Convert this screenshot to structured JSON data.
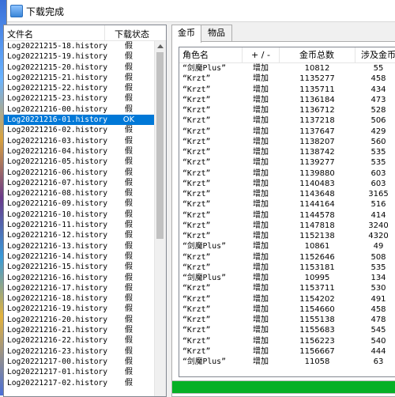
{
  "window": {
    "title": "下载完成"
  },
  "file_list": {
    "columns": [
      "文件名",
      "下载状态"
    ],
    "rows": [
      {
        "file": "Log20221215-18.history",
        "status": "假"
      },
      {
        "file": "Log20221215-19.history",
        "status": "假"
      },
      {
        "file": "Log20221215-20.history",
        "status": "假"
      },
      {
        "file": "Log20221215-21.history",
        "status": "假"
      },
      {
        "file": "Log20221215-22.history",
        "status": "假"
      },
      {
        "file": "Log20221215-23.history",
        "status": "假"
      },
      {
        "file": "Log20221216-00.history",
        "status": "假"
      },
      {
        "file": "Log20221216-01.history",
        "status": "OK",
        "selected": true
      },
      {
        "file": "Log20221216-02.history",
        "status": "假"
      },
      {
        "file": "Log20221216-03.history",
        "status": "假"
      },
      {
        "file": "Log20221216-04.history",
        "status": "假"
      },
      {
        "file": "Log20221216-05.history",
        "status": "假"
      },
      {
        "file": "Log20221216-06.history",
        "status": "假"
      },
      {
        "file": "Log20221216-07.history",
        "status": "假"
      },
      {
        "file": "Log20221216-08.history",
        "status": "假"
      },
      {
        "file": "Log20221216-09.history",
        "status": "假"
      },
      {
        "file": "Log20221216-10.history",
        "status": "假"
      },
      {
        "file": "Log20221216-11.history",
        "status": "假"
      },
      {
        "file": "Log20221216-12.history",
        "status": "假"
      },
      {
        "file": "Log20221216-13.history",
        "status": "假"
      },
      {
        "file": "Log20221216-14.history",
        "status": "假"
      },
      {
        "file": "Log20221216-15.history",
        "status": "假"
      },
      {
        "file": "Log20221216-16.history",
        "status": "假"
      },
      {
        "file": "Log20221216-17.history",
        "status": "假"
      },
      {
        "file": "Log20221216-18.history",
        "status": "假"
      },
      {
        "file": "Log20221216-19.history",
        "status": "假"
      },
      {
        "file": "Log20221216-20.history",
        "status": "假"
      },
      {
        "file": "Log20221216-21.history",
        "status": "假"
      },
      {
        "file": "Log20221216-22.history",
        "status": "假"
      },
      {
        "file": "Log20221216-23.history",
        "status": "假"
      },
      {
        "file": "Log20221217-00.history",
        "status": "假"
      },
      {
        "file": "Log20221217-01.history",
        "status": "假"
      },
      {
        "file": "Log20221217-02.history",
        "status": "假"
      }
    ]
  },
  "tabs": [
    {
      "label": "金币",
      "active": true
    },
    {
      "label": "物品",
      "active": false
    }
  ],
  "gold_table": {
    "columns": [
      "角色名",
      "+ / -",
      "金币总数",
      "涉及金币"
    ],
    "rows": [
      [
        "“剑魔Plus”",
        "增加",
        "10812",
        "55"
      ],
      [
        "“Krzt”",
        "增加",
        "1135277",
        "458"
      ],
      [
        "“Krzt”",
        "增加",
        "1135711",
        "434"
      ],
      [
        "“Krzt”",
        "增加",
        "1136184",
        "473"
      ],
      [
        "“Krzt”",
        "增加",
        "1136712",
        "528"
      ],
      [
        "“Krzt”",
        "增加",
        "1137218",
        "506"
      ],
      [
        "“Krzt”",
        "增加",
        "1137647",
        "429"
      ],
      [
        "“Krzt”",
        "增加",
        "1138207",
        "560"
      ],
      [
        "“Krzt”",
        "增加",
        "1138742",
        "535"
      ],
      [
        "“Krzt”",
        "增加",
        "1139277",
        "535"
      ],
      [
        "“Krzt”",
        "增加",
        "1139880",
        "603"
      ],
      [
        "“Krzt”",
        "增加",
        "1140483",
        "603"
      ],
      [
        "“Krzt”",
        "增加",
        "1143648",
        "3165"
      ],
      [
        "“Krzt”",
        "增加",
        "1144164",
        "516"
      ],
      [
        "“Krzt”",
        "增加",
        "1144578",
        "414"
      ],
      [
        "“Krzt”",
        "增加",
        "1147818",
        "3240"
      ],
      [
        "“Krzt”",
        "增加",
        "1152138",
        "4320"
      ],
      [
        "“剑魔Plus”",
        "增加",
        "10861",
        "49"
      ],
      [
        "“Krzt”",
        "增加",
        "1152646",
        "508"
      ],
      [
        "“Krzt”",
        "增加",
        "1153181",
        "535"
      ],
      [
        "“剑魔Plus”",
        "增加",
        "10995",
        "134"
      ],
      [
        "“Krzt”",
        "增加",
        "1153711",
        "530"
      ],
      [
        "“Krzt”",
        "增加",
        "1154202",
        "491"
      ],
      [
        "“Krzt”",
        "增加",
        "1154660",
        "458"
      ],
      [
        "“Krzt”",
        "增加",
        "1155138",
        "478"
      ],
      [
        "“Krzt”",
        "增加",
        "1155683",
        "545"
      ],
      [
        "“Krzt”",
        "增加",
        "1156223",
        "540"
      ],
      [
        "“Krzt”",
        "增加",
        "1156667",
        "444"
      ],
      [
        "“剑魔Plus”",
        "增加",
        "11058",
        "63"
      ]
    ]
  },
  "progress": {
    "fraction": 1.0,
    "color": "#06b025"
  },
  "colors": {
    "selection": "#0078d7"
  }
}
